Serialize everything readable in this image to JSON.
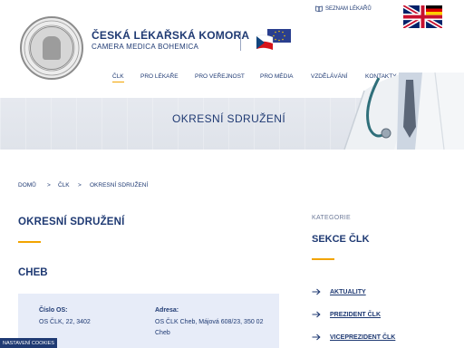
{
  "header": {
    "org_name": "ČESKÁ LÉKAŘSKÁ KOMORA",
    "org_subtitle": "CAMERA MEDICA BOHEMICA",
    "seal_text": "ČESKÁ LÉKAŘSKÁ KOMORA"
  },
  "topbar": {
    "doctors_list_label": "SEZNAM LÉKAŘŮ",
    "lang_en_icon": "uk-flag-icon",
    "lang_de_icon": "de-flag-icon"
  },
  "nav": {
    "items": [
      {
        "label": "ČLK",
        "active": true
      },
      {
        "label": "PRO LÉKAŘE",
        "active": false
      },
      {
        "label": "PRO VEŘEJNOST",
        "active": false
      },
      {
        "label": "PRO MÉDIA",
        "active": false
      },
      {
        "label": "VZDĚLÁVÁNÍ",
        "active": false
      },
      {
        "label": "KONTAKTY",
        "active": false
      }
    ],
    "search_icon": "search-icon"
  },
  "banner": {
    "title": "OKRESNÍ SDRUŽENÍ"
  },
  "breadcrumb": {
    "items": [
      "DOMŮ",
      "ČLK",
      "OKRESNÍ SDRUŽENÍ"
    ],
    "separator": ">"
  },
  "main": {
    "title": "OKRESNÍ SDRUŽENÍ",
    "region": "CHEB",
    "card": {
      "number_label": "Číslo OS:",
      "number_value": "OS ČLK, 22, 3402",
      "address_label": "Adresa:",
      "address_value": "OS ČLK Cheb, Májová 608/23, 350 02 Cheb"
    }
  },
  "sidebar": {
    "category_label": "KATEGORIE",
    "section_title": "SEKCE ČLK",
    "links": [
      "AKTUALITY",
      "PREZIDENT ČLK",
      "VICEPREZIDENT ČLK"
    ]
  },
  "cookies": {
    "label": "NASTAVENÍ COOKIES"
  },
  "colors": {
    "primary": "#1f3a73",
    "accent": "#f2a400",
    "card_bg": "#e7ecf8",
    "banner_bg": "#e2e6ed"
  }
}
